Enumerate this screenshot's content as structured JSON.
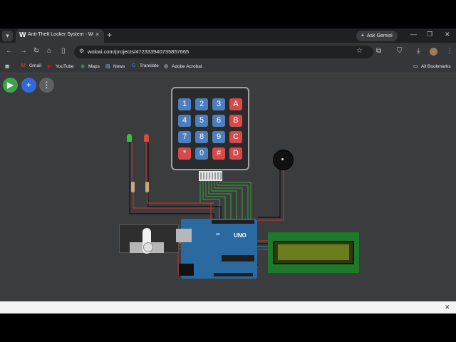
{
  "browser": {
    "tab": {
      "title": "Anti-Theft Locker System - Wo…",
      "favicon": "W",
      "close": "×"
    },
    "new_tab": "+",
    "gemini_label": "Ask Gemini",
    "window_controls": {
      "minimize": "—",
      "restore": "❐",
      "close": "✕"
    },
    "nav": {
      "back": "←",
      "forward": "→",
      "reload": "↻",
      "home": "⌂",
      "split": "▯"
    },
    "url": "wokwi.com/projects/472333940735857665",
    "bookmarks": [
      {
        "label": "Gmail",
        "icon": "M"
      },
      {
        "label": "YouTube",
        "icon": "▶"
      },
      {
        "label": "Maps",
        "icon": "◉"
      },
      {
        "label": "News",
        "icon": "▤"
      },
      {
        "label": "Translate",
        "icon": "G"
      },
      {
        "label": "Adobe Acrobat",
        "icon": "◎"
      }
    ],
    "all_bookmarks": "All Bookmarks",
    "colors": {
      "titlebar": "#1f2023",
      "toolbar": "#35363a",
      "omnibox": "#202124"
    }
  },
  "simulator": {
    "buttons": {
      "play": "▶",
      "add": "+",
      "more": "⋮"
    },
    "keypad": {
      "rows": [
        [
          "1",
          "2",
          "3",
          "A"
        ],
        [
          "4",
          "5",
          "6",
          "B"
        ],
        [
          "7",
          "8",
          "9",
          "C"
        ],
        [
          "*",
          "0",
          "#",
          "D"
        ]
      ]
    },
    "arduino_label": "UNO",
    "arduino_logo": "∞",
    "colors": {
      "canvas": "#3b3c3e",
      "key_blue": "#4d7fbf",
      "key_red": "#d64a4a",
      "uno": "#2b6aa0",
      "lcd_board": "#1c7a2a"
    }
  }
}
